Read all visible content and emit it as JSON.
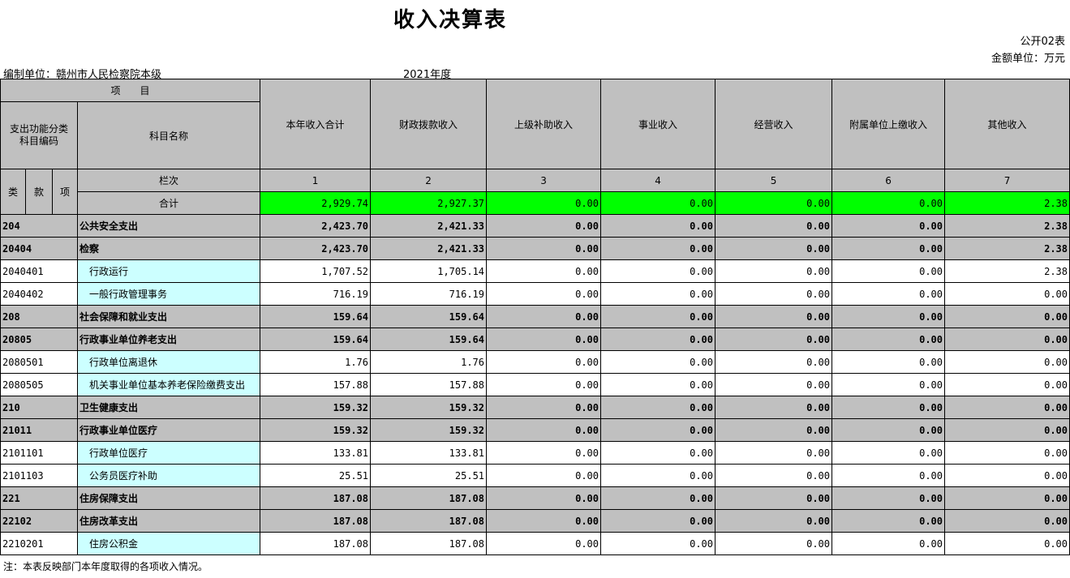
{
  "title": "收入决算表",
  "form_no": "公开02表",
  "unit": "金额单位：万元",
  "org": "编制单位：赣州市人民检察院本级",
  "year": "2021年度",
  "headers": {
    "item": "项　　目",
    "code": "支出功能分类\n科目编码",
    "name": "科目名称",
    "col_label": "栏次",
    "lei": "类",
    "kuan": "款",
    "xiang": "项",
    "total_label": "合计",
    "columns": [
      "本年收入合计",
      "财政拨款收入",
      "上级补助收入",
      "事业收入",
      "经营收入",
      "附属单位上缴收入",
      "其他收入"
    ],
    "column_numbers": [
      "1",
      "2",
      "3",
      "4",
      "5",
      "6",
      "7"
    ]
  },
  "totals": [
    "2,929.74",
    "2,927.37",
    "0.00",
    "0.00",
    "0.00",
    "0.00",
    "2.38"
  ],
  "rows": [
    {
      "code": "204",
      "name": "公共安全支出",
      "level": "gray",
      "values": [
        "2,423.70",
        "2,421.33",
        "0.00",
        "0.00",
        "0.00",
        "0.00",
        "2.38"
      ]
    },
    {
      "code": "20404",
      "name": "检察",
      "level": "gray",
      "values": [
        "2,423.70",
        "2,421.33",
        "0.00",
        "0.00",
        "0.00",
        "0.00",
        "2.38"
      ]
    },
    {
      "code": "2040401",
      "name": "行政运行",
      "level": "leaf",
      "values": [
        "1,707.52",
        "1,705.14",
        "0.00",
        "0.00",
        "0.00",
        "0.00",
        "2.38"
      ]
    },
    {
      "code": "2040402",
      "name": "一般行政管理事务",
      "level": "leaf",
      "values": [
        "716.19",
        "716.19",
        "0.00",
        "0.00",
        "0.00",
        "0.00",
        "0.00"
      ]
    },
    {
      "code": "208",
      "name": "社会保障和就业支出",
      "level": "gray",
      "values": [
        "159.64",
        "159.64",
        "0.00",
        "0.00",
        "0.00",
        "0.00",
        "0.00"
      ]
    },
    {
      "code": "20805",
      "name": "行政事业单位养老支出",
      "level": "gray",
      "values": [
        "159.64",
        "159.64",
        "0.00",
        "0.00",
        "0.00",
        "0.00",
        "0.00"
      ]
    },
    {
      "code": "2080501",
      "name": "行政单位离退休",
      "level": "leaf",
      "values": [
        "1.76",
        "1.76",
        "0.00",
        "0.00",
        "0.00",
        "0.00",
        "0.00"
      ]
    },
    {
      "code": "2080505",
      "name": "机关事业单位基本养老保险缴费支出",
      "level": "leaf",
      "values": [
        "157.88",
        "157.88",
        "0.00",
        "0.00",
        "0.00",
        "0.00",
        "0.00"
      ]
    },
    {
      "code": "210",
      "name": "卫生健康支出",
      "level": "gray",
      "values": [
        "159.32",
        "159.32",
        "0.00",
        "0.00",
        "0.00",
        "0.00",
        "0.00"
      ]
    },
    {
      "code": "21011",
      "name": "行政事业单位医疗",
      "level": "gray",
      "values": [
        "159.32",
        "159.32",
        "0.00",
        "0.00",
        "0.00",
        "0.00",
        "0.00"
      ]
    },
    {
      "code": "2101101",
      "name": "行政单位医疗",
      "level": "leaf",
      "values": [
        "133.81",
        "133.81",
        "0.00",
        "0.00",
        "0.00",
        "0.00",
        "0.00"
      ]
    },
    {
      "code": "2101103",
      "name": "公务员医疗补助",
      "level": "leaf",
      "values": [
        "25.51",
        "25.51",
        "0.00",
        "0.00",
        "0.00",
        "0.00",
        "0.00"
      ]
    },
    {
      "code": "221",
      "name": "住房保障支出",
      "level": "gray",
      "values": [
        "187.08",
        "187.08",
        "0.00",
        "0.00",
        "0.00",
        "0.00",
        "0.00"
      ]
    },
    {
      "code": "22102",
      "name": "住房改革支出",
      "level": "gray",
      "values": [
        "187.08",
        "187.08",
        "0.00",
        "0.00",
        "0.00",
        "0.00",
        "0.00"
      ]
    },
    {
      "code": "2210201",
      "name": "住房公积金",
      "level": "leaf",
      "values": [
        "187.08",
        "187.08",
        "0.00",
        "0.00",
        "0.00",
        "0.00",
        "0.00"
      ]
    }
  ],
  "note": "注：本表反映部门本年度取得的各项收入情况。"
}
